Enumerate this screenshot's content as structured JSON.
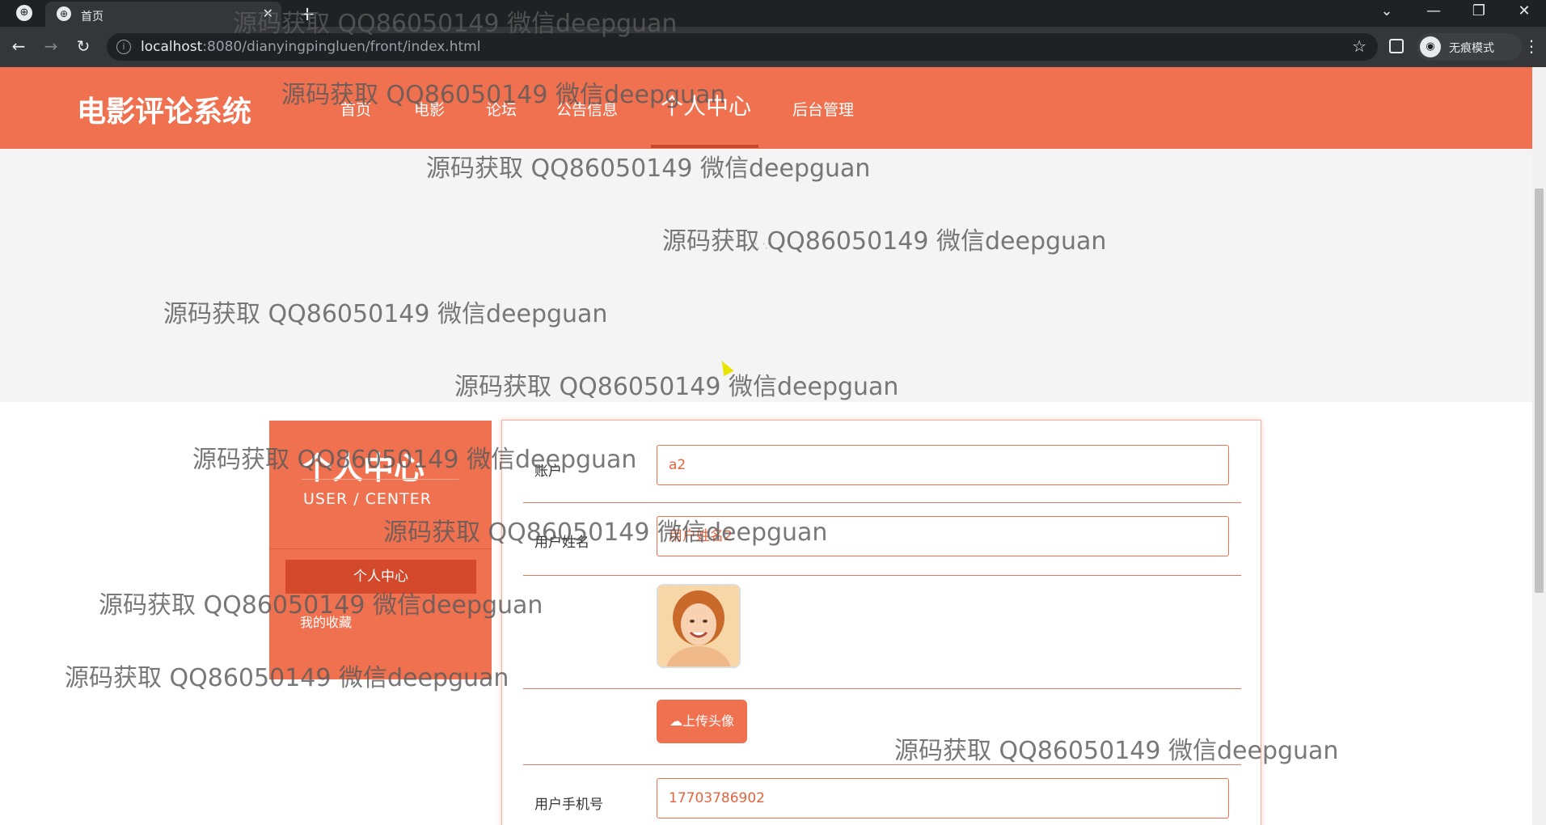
{
  "browser": {
    "tab_title": "首页",
    "url_host": "localhost",
    "url_rest": ":8080/dianyingpingluen/front/index.html",
    "incognito_label": "无痕模式"
  },
  "header": {
    "site_title": "电影评论系统",
    "nav": [
      "首页",
      "电影",
      "论坛",
      "公告信息",
      "个人中心",
      "后台管理"
    ],
    "active_nav": "个人中心"
  },
  "sidebar": {
    "title": "个人中心",
    "subtitle": "USER / CENTER",
    "items": [
      {
        "label": "个人中心",
        "active": true
      },
      {
        "label": "我的收藏",
        "active": false
      }
    ]
  },
  "form": {
    "account_label": "账户",
    "account_value": "a2",
    "name_label": "用户姓名",
    "name_value": "用户姓名2",
    "avatar_icon": "user-photo",
    "upload_label": "上传头像",
    "upload_icon": "cloud-upload-icon",
    "phone_label": "用户手机号",
    "phone_value": "17703786902"
  },
  "watermark": "源码获取 QQ86050149 微信deepguan",
  "colors": {
    "accent": "#f07150",
    "accent_dark": "#d4492b",
    "chrome_dark": "#202124"
  }
}
